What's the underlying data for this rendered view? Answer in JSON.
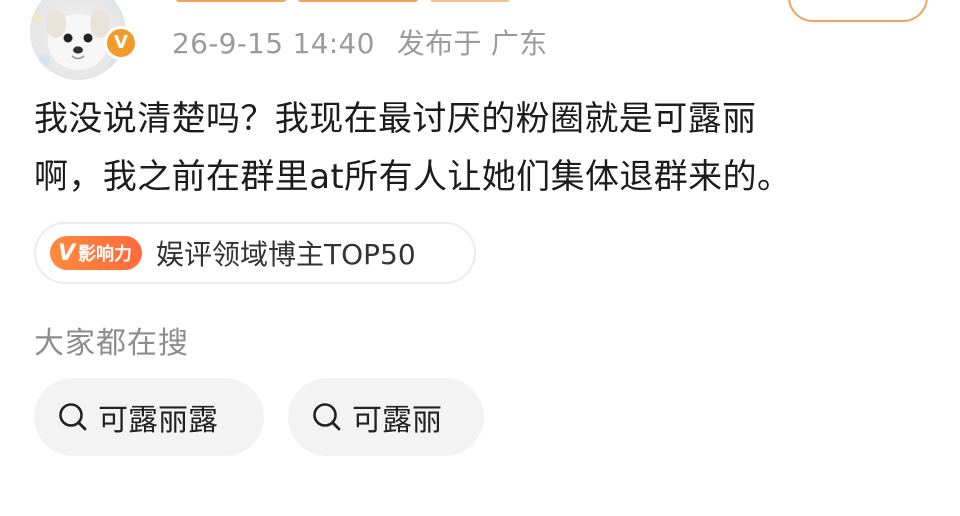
{
  "post": {
    "timestamp": "26-9-15 14:40",
    "published_from": "发布于 广东",
    "text_line1": "我没说清楚吗？我现在最讨厌的粉圈就是可露丽",
    "text_line2": "啊，我之前在群里at所有人让她们集体退群来的。"
  },
  "author": {
    "verified_mark": "V",
    "badge_color": "#f49a2a"
  },
  "influence": {
    "badge_mark": "V",
    "badge_text": "影响力",
    "label": "娱评领域博主TOP50",
    "accent": "#ff7a3d"
  },
  "search": {
    "title": "大家都在搜",
    "chips": [
      {
        "label": "可露丽露",
        "icon": "search-icon"
      },
      {
        "label": "可露丽",
        "icon": "search-icon"
      }
    ]
  },
  "colors": {
    "follow_border": "#f7a25a",
    "meta_text": "#9b9b9b",
    "chip_bg": "#f3f3f3"
  }
}
